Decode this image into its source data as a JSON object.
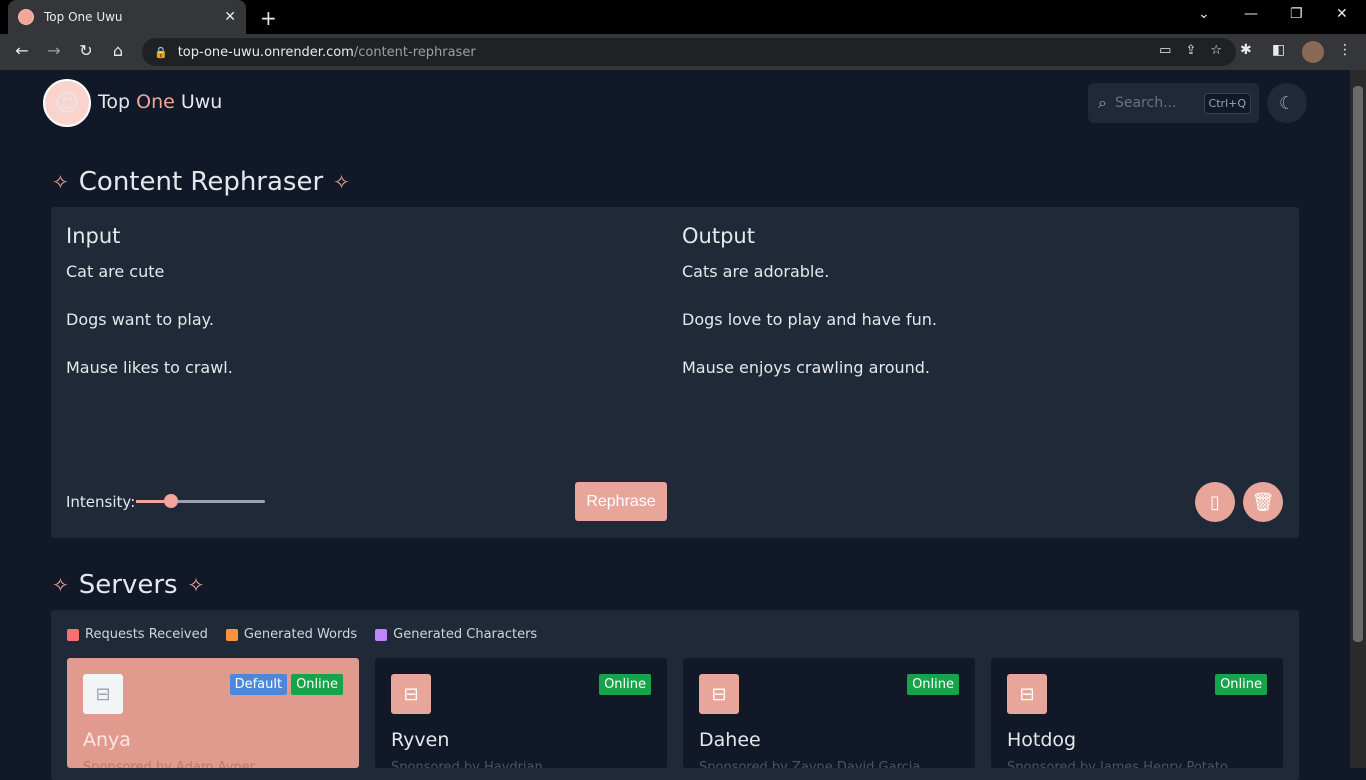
{
  "browser": {
    "tab_title": "Top One Uwu",
    "url_host": "top-one-uwu.onrender.com",
    "url_path": "/content-rephraser"
  },
  "header": {
    "brand_first": "Top",
    "brand_accent": "One",
    "brand_last": "Uwu",
    "search_placeholder": "Search...",
    "search_shortcut": "Ctrl+Q"
  },
  "rephraser": {
    "title": "Content Rephraser",
    "input_label": "Input",
    "output_label": "Output",
    "input_lines": [
      "Cat are cute",
      "Dogs want to play.",
      "Mause likes to crawl."
    ],
    "output_lines": [
      "Cats are adorable.",
      "Dogs love to play and have fun.",
      "Mause enjoys crawling around."
    ],
    "intensity_label": "Intensity:",
    "intensity_value": 0.27,
    "rephrase_label": "Rephrase"
  },
  "servers": {
    "title": "Servers",
    "legend": [
      {
        "label": "Requests Received",
        "color": "#f87171"
      },
      {
        "label": "Generated Words",
        "color": "#fb923c"
      },
      {
        "label": "Generated Characters",
        "color": "#c084fc"
      }
    ],
    "cards": [
      {
        "name": "Anya",
        "sub": "Sponsored by Adam Avner",
        "default_badge": "Default",
        "status": "Online"
      },
      {
        "name": "Ryven",
        "sub": "Sponsored by Haydrian",
        "status": "Online"
      },
      {
        "name": "Dahee",
        "sub": "Sponsored by Zayne David Garcia",
        "status": "Online"
      },
      {
        "name": "Hotdog",
        "sub": "Sponsored by James Henry Potato",
        "status": "Online"
      }
    ]
  },
  "colors": {
    "accent": "#f3a59a",
    "online": "#16a34a",
    "default_badge": "#4f87d8"
  }
}
